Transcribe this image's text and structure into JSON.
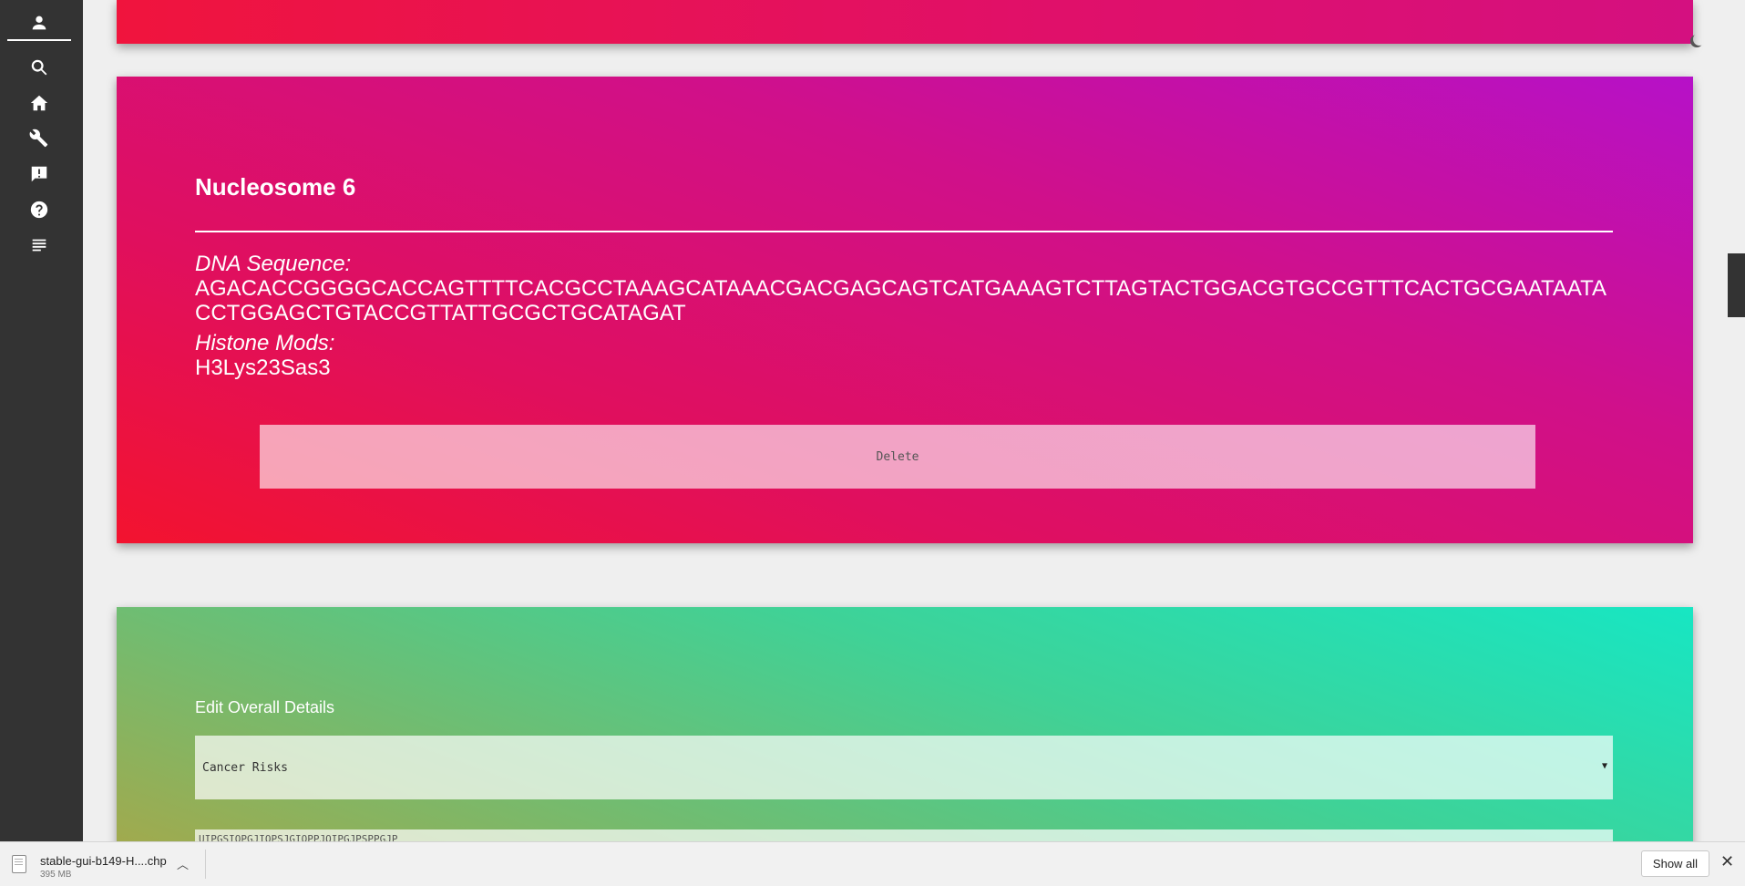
{
  "sidebar": {
    "items": [
      {
        "icon": "person-icon",
        "name": "sidebar-item-profile"
      },
      {
        "icon": "search-icon",
        "name": "sidebar-item-search"
      },
      {
        "icon": "home-icon",
        "name": "sidebar-item-home"
      },
      {
        "icon": "wrench-icon",
        "name": "sidebar-item-tools"
      },
      {
        "icon": "feedback-icon",
        "name": "sidebar-item-feedback"
      },
      {
        "icon": "help-icon",
        "name": "sidebar-item-help"
      },
      {
        "icon": "list-icon",
        "name": "sidebar-item-list"
      }
    ]
  },
  "nucleosome": {
    "title": "Nucleosome 6",
    "dna_label": "DNA Sequence:",
    "dna_value": "AGACACCGGGGCACCAGTTTTCACGCCTAAAGCATAAACGACGAGCAGTCATGAAAGTCTTAGTACTGGACGTGCCGTTTCACTGCGAATAATACCTGGAGCTGTACCGTTATTGCGCTGCATAGAT",
    "mods_label": "Histone Mods:",
    "mods_value": "H3Lys23Sas3",
    "delete_label": "Delete",
    "colors": {
      "start": "#f3132f",
      "end": "#b611c8"
    }
  },
  "edit": {
    "title": "Edit Overall Details",
    "select_value": "Cancer Risks",
    "field_value": "UIPGSIOPGJIOPSJGIOPPJOIPGJPSPPGJP"
  },
  "download_bar": {
    "file_name": "stable-gui-b149-H....chp",
    "file_size": "395 MB",
    "show_all_label": "Show all"
  }
}
